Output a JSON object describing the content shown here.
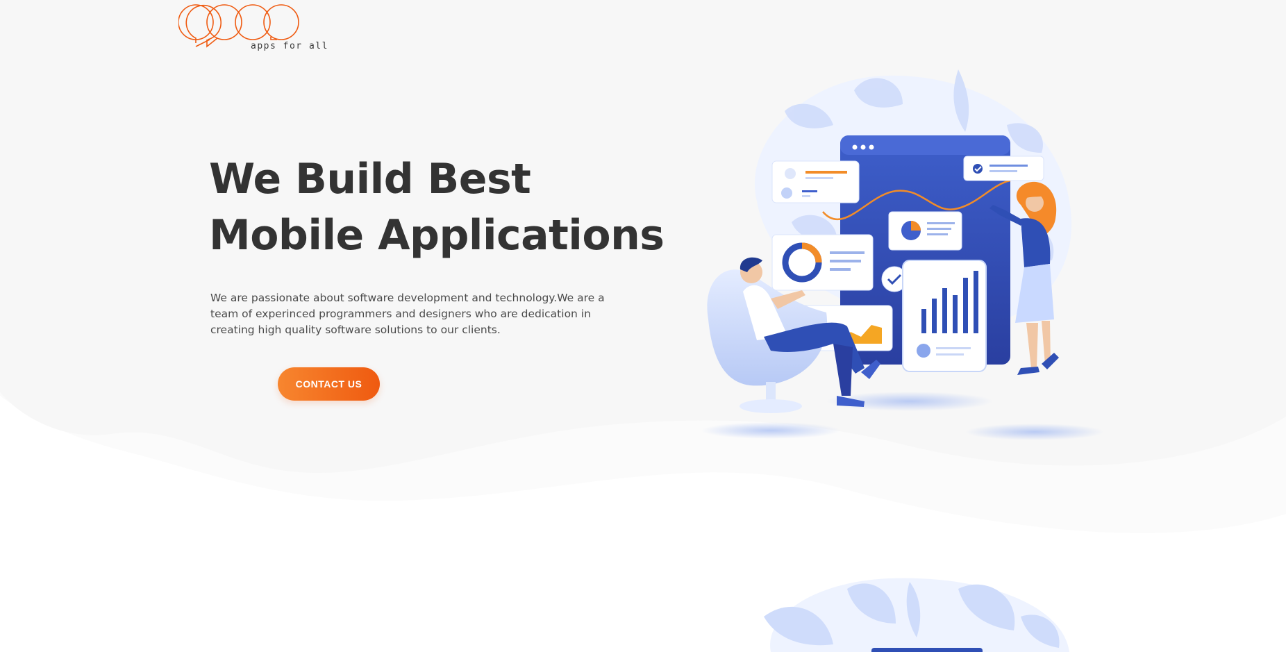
{
  "brand": {
    "tagline": "apps for all",
    "accent_color": "#ef5a10",
    "logo_icon": "speech-bubbles-logo"
  },
  "hero": {
    "title_line1": "We Build Best",
    "title_line2": "Mobile Applications",
    "description": "We are passionate about software development and technology.We are a team of experinced programmers and designers who are dedication in creating high quality software solutions to our clients.",
    "cta_label": "CONTACT US",
    "illustration_icon": "team-analytics-dashboard-illustration"
  },
  "colors": {
    "heading": "#333333",
    "body_text": "#4a4a4a",
    "hero_background": "#f7f7f7",
    "illustration_blue": "#2f4fb5",
    "illustration_light": "#c9d9ff"
  }
}
